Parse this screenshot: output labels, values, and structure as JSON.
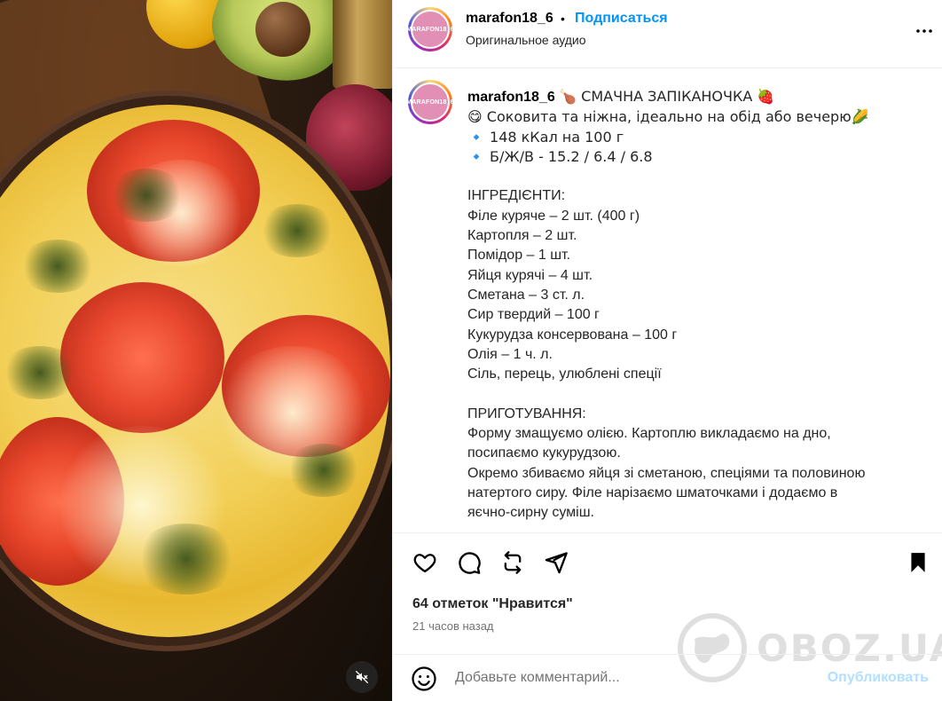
{
  "post": {
    "username": "marafon18_6",
    "separator": "•",
    "follow_label": "Подписаться",
    "audio_label": "Оригинальное аудио",
    "avatar_text": "MARAFON18_6"
  },
  "caption": {
    "username": "marafon18_6",
    "lines": [
      "🍗 СМАЧНА ЗАПІКАНОЧКА 🍓",
      "😋 Соковита та ніжна, ідеально на обід або вечерю🌽",
      "🔹 148 кКал на 100 г",
      "🔹 Б/Ж/В - 15.2 / 6.4 / 6.8",
      " ",
      "ІНГРЕДІЄНТИ:",
      "Філе куряче – 2 шт. (400 г)",
      "Картопля – 2 шт.",
      "Помідор – 1 шт.",
      "Яйця курячі – 4 шт.",
      "Сметана – 3 ст. л.",
      "Сир твердий – 100 г",
      "Кукурудза консервована – 100 г",
      "Олія – 1 ч. л.",
      "Сіль, перець, улюблені спеції",
      " ",
      "ПРИГОТУВАННЯ:",
      "Форму змащуємо олією. Картоплю викладаємо на дно,",
      "посипаємо кукурудзою.",
      "Окремо збиваємо яйця зі сметаною, спеціями та половиною",
      "натертого сиру. Філе нарізаємо шматочками і додаємо в",
      "яєчно-сирну суміш."
    ]
  },
  "actions": {
    "like_icon": "heart-icon",
    "comment_icon": "comment-icon",
    "repost_icon": "repost-icon",
    "share_icon": "share-icon",
    "save_icon": "bookmark-icon"
  },
  "stats": {
    "likes": "64 отметок \"Нравится\"",
    "time": "21 часов назад"
  },
  "comment": {
    "placeholder": "Добавьте комментарий...",
    "publish_label": "Опубликовать"
  },
  "watermark": {
    "text": "OBOZ.UA"
  },
  "colors": {
    "accent": "#0095f6",
    "publish_disabled": "#b2dffc",
    "muted_text": "#737373"
  }
}
